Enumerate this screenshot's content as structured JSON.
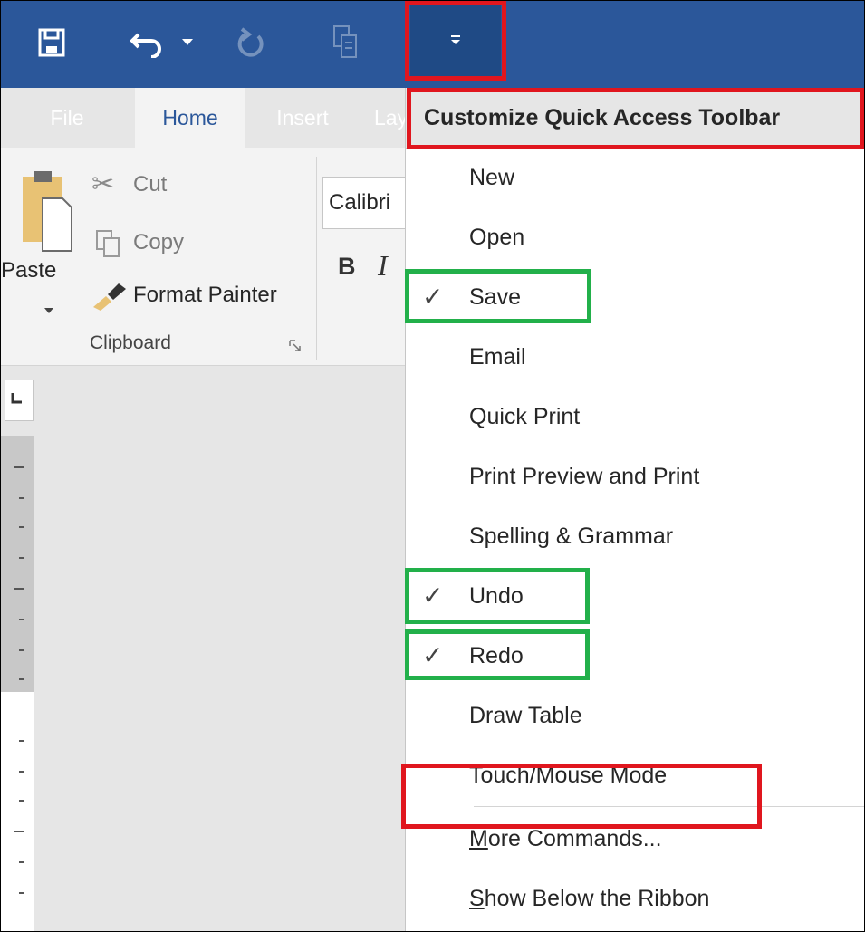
{
  "qat": {
    "save_icon": "save-icon",
    "undo_icon": "undo-icon",
    "undo_dropdown_icon": "caret-down-icon",
    "redo_icon": "redo-icon",
    "paste_icon": "paste-icon",
    "customize_icon": "customize-qat-icon",
    "bar_color": "#2b579a"
  },
  "tabs": [
    {
      "label": "File"
    },
    {
      "label": "Home",
      "active": true
    },
    {
      "label": "Insert"
    },
    {
      "label": "Lay"
    }
  ],
  "ribbon": {
    "paste_label": "Paste",
    "cut_label": "Cut",
    "copy_label": "Copy",
    "format_painter_label": "Format Painter",
    "clipboard_group_label": "Clipboard",
    "font_name": "Calibri",
    "bold_label": "B",
    "italic_label": "I"
  },
  "menu": {
    "title": "Customize Quick Access Toolbar",
    "items": [
      {
        "label": "New",
        "checked": false
      },
      {
        "label": "Open",
        "checked": false
      },
      {
        "label": "Save",
        "checked": true
      },
      {
        "label": "Email",
        "checked": false
      },
      {
        "label": "Quick Print",
        "checked": false
      },
      {
        "label": "Print Preview and Print",
        "checked": false
      },
      {
        "label": "Spelling & Grammar",
        "checked": false
      },
      {
        "label": "Undo",
        "checked": true
      },
      {
        "label": "Redo",
        "checked": true
      },
      {
        "label": "Draw Table",
        "checked": false
      },
      {
        "label": "Touch/Mouse Mode",
        "checked": false
      },
      {
        "label_first": "M",
        "label_rest": "ore Commands...",
        "checked": false
      },
      {
        "label_first": "S",
        "label_rest": "how Below the Ribbon",
        "checked": false
      }
    ],
    "check_glyph": "✓"
  },
  "colors": {
    "highlight_red": "#e0161e",
    "highlight_green": "#22b04a"
  }
}
